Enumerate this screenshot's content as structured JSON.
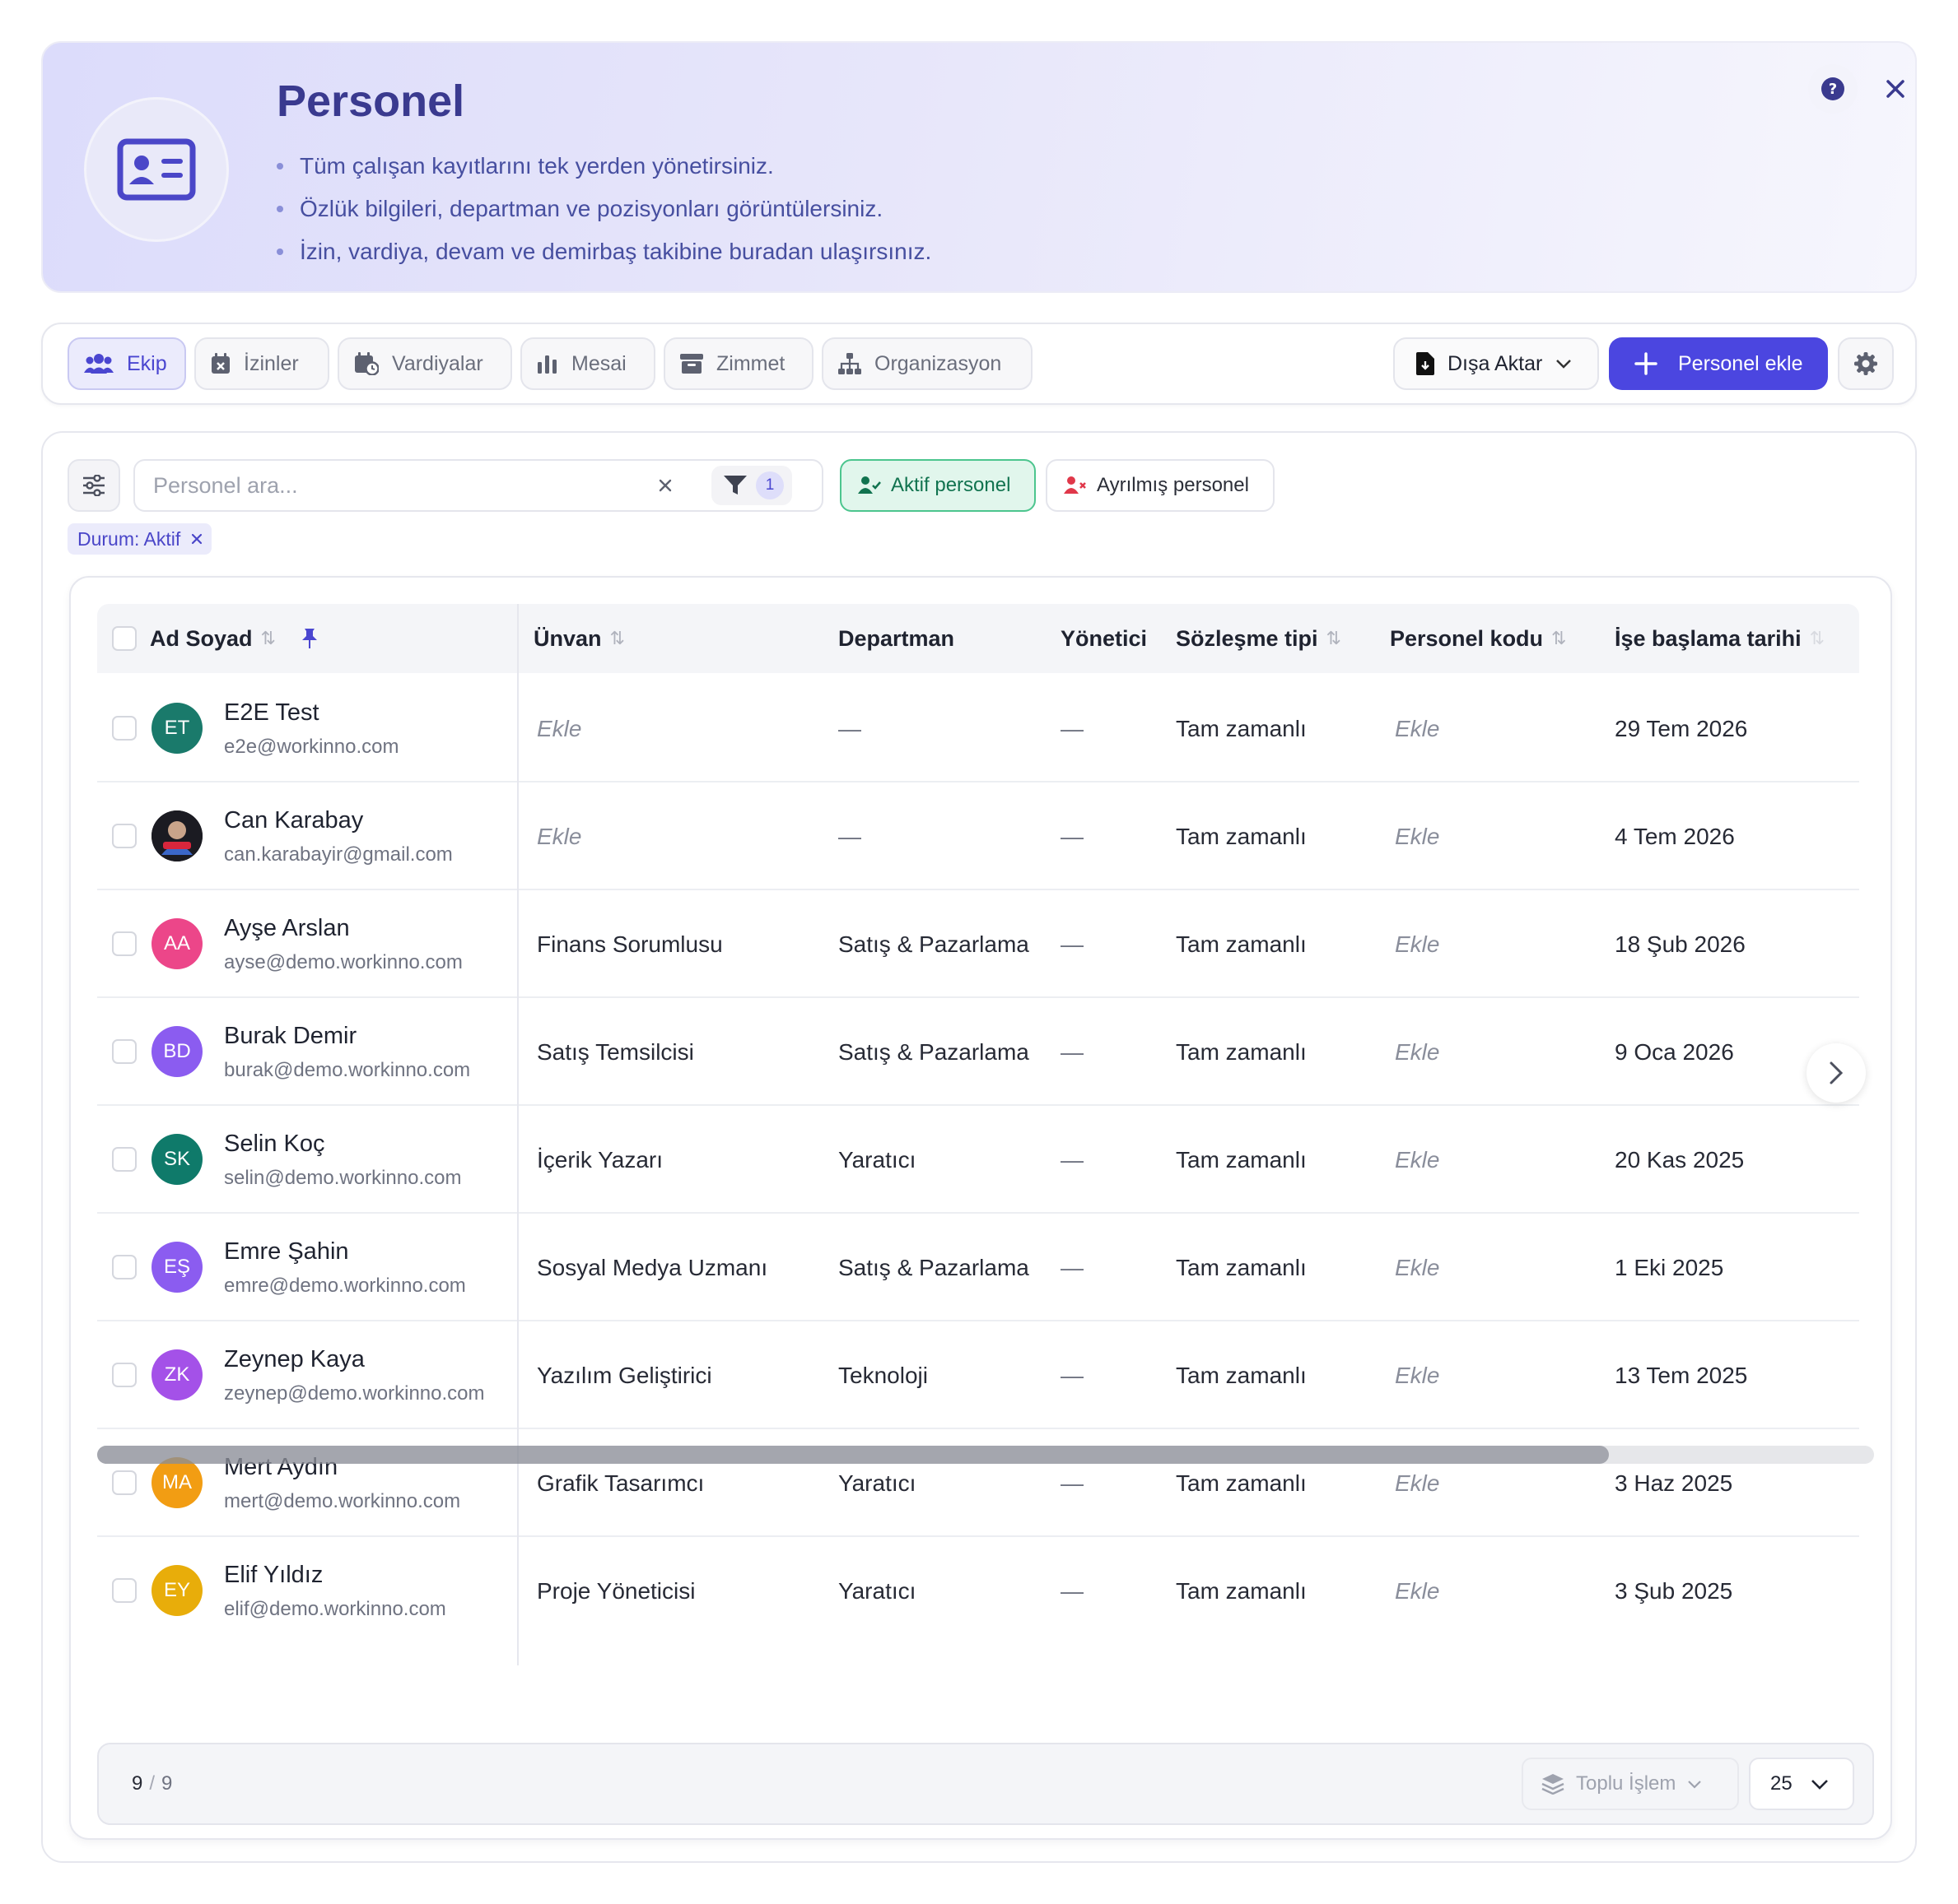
{
  "header": {
    "title": "Personel",
    "bullets": [
      "Tüm çalışan kayıtlarını tek yerden yönetirsiniz.",
      "Özlük bilgileri, departman ve pozisyonları görüntülersiniz.",
      "İzin, vardiya, devam ve demirbaş takibine buradan ulaşırsınız."
    ]
  },
  "tabs": [
    {
      "label": "Ekip",
      "icon": "users-icon"
    },
    {
      "label": "İzinler",
      "icon": "calendar-x-icon"
    },
    {
      "label": "Vardiyalar",
      "icon": "calendar-clock-icon"
    },
    {
      "label": "Mesai",
      "icon": "bar-chart-icon"
    },
    {
      "label": "Zimmet",
      "icon": "archive-icon"
    },
    {
      "label": "Organizasyon",
      "icon": "org-chart-icon"
    }
  ],
  "toolbar": {
    "export_label": "Dışa Aktar",
    "add_label": "Personel ekle"
  },
  "filters": {
    "search_placeholder": "Personel ara...",
    "filter_count": "1",
    "active_label": "Aktif personel",
    "left_label": "Ayrılmış personel",
    "chip_label": "Durum: Aktif"
  },
  "table": {
    "columns": [
      "Ad Soyad",
      "Ünvan",
      "Departman",
      "Yönetici",
      "Sözleşme tipi",
      "Personel kodu",
      "İşe başlama tarihi"
    ],
    "rows": [
      {
        "initials": "ET",
        "color": "#1a7a6b",
        "name": "E2E Test",
        "email": "e2e@workinno.com",
        "title": "Ekle",
        "title_empty": true,
        "department": "—",
        "manager": "—",
        "contract": "Tam zamanlı",
        "code": "Ekle",
        "start": "29 Tem 2026"
      },
      {
        "initials": "",
        "color": "#1b1b22",
        "name": "Can Karabay",
        "email": "can.karabayir@gmail.com",
        "title": "Ekle",
        "title_empty": true,
        "department": "—",
        "manager": "—",
        "contract": "Tam zamanlı",
        "code": "Ekle",
        "start": "4 Tem 2026"
      },
      {
        "initials": "AA",
        "color": "#ec4689",
        "name": "Ayşe Arslan",
        "email": "ayse@demo.workinno.com",
        "title": "Finans Sorumlusu",
        "title_empty": false,
        "department": "Satış & Pazarlama",
        "manager": "—",
        "contract": "Tam zamanlı",
        "code": "Ekle",
        "start": "18 Şub 2026"
      },
      {
        "initials": "BD",
        "color": "#8b5cf0",
        "name": "Burak Demir",
        "email": "burak@demo.workinno.com",
        "title": "Satış Temsilcisi",
        "title_empty": false,
        "department": "Satış & Pazarlama",
        "manager": "—",
        "contract": "Tam zamanlı",
        "code": "Ekle",
        "start": "9 Oca 2026"
      },
      {
        "initials": "SK",
        "color": "#0f7a6a",
        "name": "Selin Koç",
        "email": "selin@demo.workinno.com",
        "title": "İçerik Yazarı",
        "title_empty": false,
        "department": "Yaratıcı",
        "manager": "—",
        "contract": "Tam zamanlı",
        "code": "Ekle",
        "start": "20 Kas 2025"
      },
      {
        "initials": "EŞ",
        "color": "#8b5cf0",
        "name": "Emre Şahin",
        "email": "emre@demo.workinno.com",
        "title": "Sosyal Medya Uzmanı",
        "title_empty": false,
        "department": "Satış & Pazarlama",
        "manager": "—",
        "contract": "Tam zamanlı",
        "code": "Ekle",
        "start": "1 Eki 2025"
      },
      {
        "initials": "ZK",
        "color": "#a451e8",
        "name": "Zeynep Kaya",
        "email": "zeynep@demo.workinno.com",
        "title": "Yazılım Geliştirici",
        "title_empty": false,
        "department": "Teknoloji",
        "manager": "—",
        "contract": "Tam zamanlı",
        "code": "Ekle",
        "start": "13 Tem 2025"
      },
      {
        "initials": "MA",
        "color": "#f29d13",
        "name": "Mert Aydın",
        "email": "mert@demo.workinno.com",
        "title": "Grafik Tasarımcı",
        "title_empty": false,
        "department": "Yaratıcı",
        "manager": "—",
        "contract": "Tam zamanlı",
        "code": "Ekle",
        "start": "3 Haz 2025"
      },
      {
        "initials": "EY",
        "color": "#e8ad0a",
        "name": "Elif Yıldız",
        "email": "elif@demo.workinno.com",
        "title": "Proje Yöneticisi",
        "title_empty": false,
        "department": "Yaratıcı",
        "manager": "—",
        "contract": "Tam zamanlı",
        "code": "Ekle",
        "start": "3 Şub 2025"
      }
    ]
  },
  "footer": {
    "shown": "9",
    "separator": "/",
    "total": "9",
    "bulk_label": "Toplu İşlem",
    "page_size": "25"
  },
  "colors": {
    "accent": "#4b46e0",
    "active_green": "#11734f",
    "banner_title": "#3a3a8f"
  }
}
